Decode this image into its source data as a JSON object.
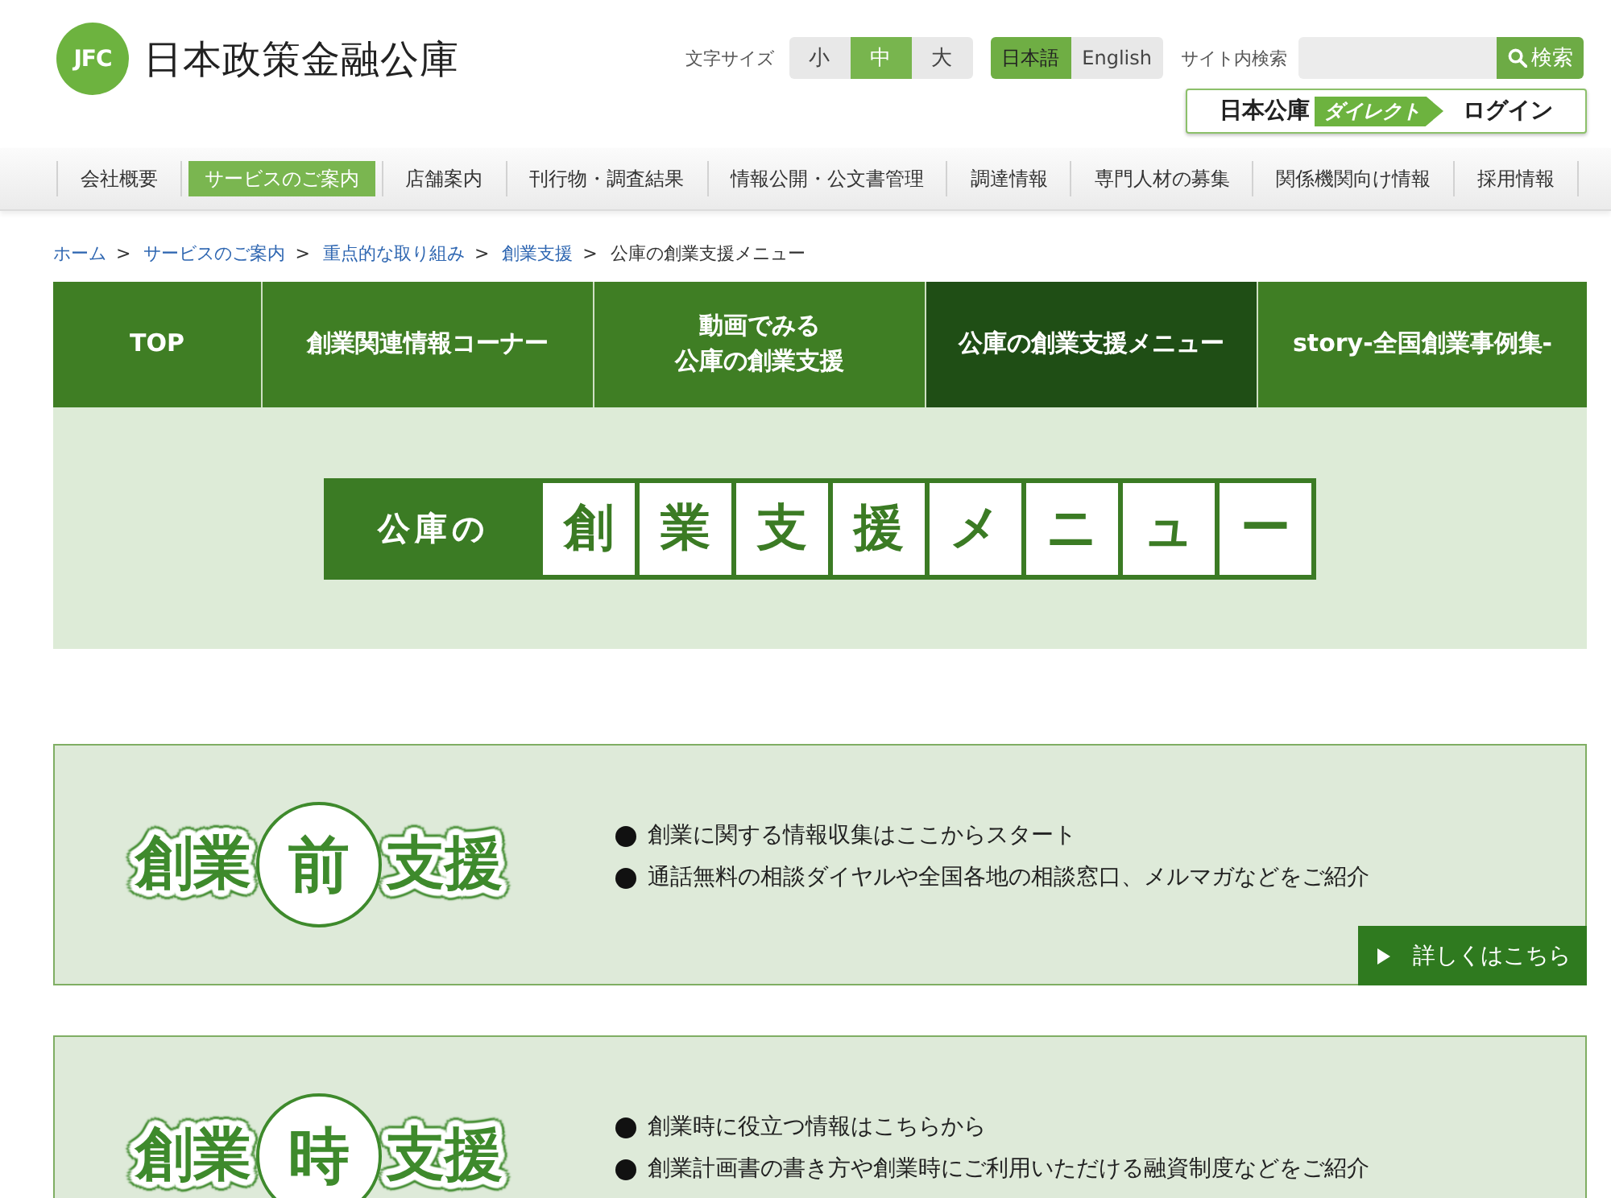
{
  "header": {
    "logo": {
      "mark": "JFC",
      "name": "日本政策金融公庫"
    },
    "font_size": {
      "label": "文字サイズ",
      "options": [
        {
          "label": "小",
          "selected": false
        },
        {
          "label": "中",
          "selected": true
        },
        {
          "label": "大",
          "selected": false
        }
      ]
    },
    "languages": [
      {
        "label": "日本語",
        "selected": true
      },
      {
        "label": "English",
        "selected": false
      }
    ],
    "search": {
      "label": "サイト内検索",
      "button": "検索"
    },
    "direct_login": {
      "brand": "日本公庫",
      "badge": "ダイレクト",
      "action": "ログイン"
    }
  },
  "global_nav": [
    {
      "label": "会社概要",
      "selected": false
    },
    {
      "label": "サービスのご案内",
      "selected": true
    },
    {
      "label": "店舗案内",
      "selected": false
    },
    {
      "label": "刊行物・調査結果",
      "selected": false
    },
    {
      "label": "情報公開・公文書管理",
      "selected": false
    },
    {
      "label": "調達情報",
      "selected": false
    },
    {
      "label": "専門人材の募集",
      "selected": false
    },
    {
      "label": "関係機関向け情報",
      "selected": false
    },
    {
      "label": "採用情報",
      "selected": false
    }
  ],
  "breadcrumb": {
    "separator": ">",
    "items": [
      {
        "label": "ホーム",
        "current": false
      },
      {
        "label": "サービスのご案内",
        "current": false
      },
      {
        "label": "重点的な取り組み",
        "current": false
      },
      {
        "label": "創業支援",
        "current": false
      },
      {
        "label": "公庫の創業支援メニュー",
        "current": true
      }
    ]
  },
  "section_tabs": [
    {
      "lines": [
        "TOP"
      ],
      "selected": false
    },
    {
      "lines": [
        "創業関連情報コーナー"
      ],
      "selected": false
    },
    {
      "lines": [
        "動画でみる",
        "公庫の創業支援"
      ],
      "selected": false
    },
    {
      "lines": [
        "公庫の創業支援メニュー"
      ],
      "selected": true
    },
    {
      "lines": [
        "story-全国創業事例集-"
      ],
      "selected": false
    }
  ],
  "banner": {
    "lead": "公庫の",
    "tiles": [
      "創",
      "業",
      "支",
      "援",
      "メ",
      "ニ",
      "ュ",
      "ー"
    ]
  },
  "cards": [
    {
      "title": "創業**前**支援",
      "bullets": [
        "創業に関する情報収集はここからスタート",
        "通話無料の相談ダイヤルや全国各地の相談窓口、メルマガなどをご紹介"
      ],
      "button": "詳しくはこちら"
    },
    {
      "title": "創業**時**支援",
      "bullets": [
        "創業時に役立つ情報はこちらから",
        "創業計画書の書き方や創業時にご利用いただける融資制度などをご紹介"
      ]
    }
  ]
}
